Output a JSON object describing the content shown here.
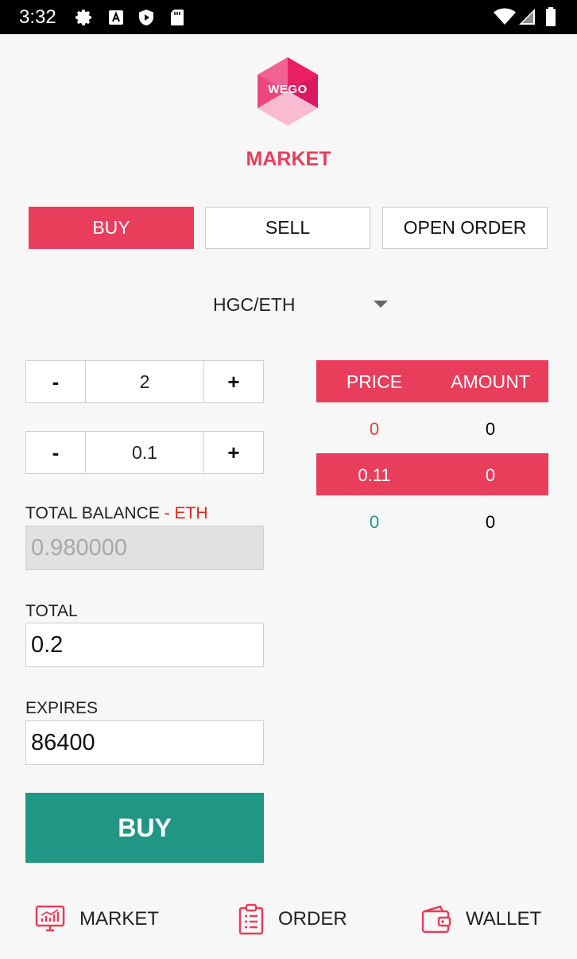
{
  "status_bar": {
    "time": "3:32",
    "icons": [
      "gear-icon",
      "font-a-icon",
      "shield-play-icon",
      "sd-card-icon",
      "wifi-icon",
      "cell-signal-icon",
      "battery-icon"
    ]
  },
  "app": {
    "logo_text": "WEGO",
    "title": "MARKET",
    "accent_color": "#e83e5c",
    "buy_color": "#219685"
  },
  "tabs": [
    {
      "label": "BUY",
      "active": true
    },
    {
      "label": "SELL",
      "active": false
    },
    {
      "label": "OPEN ORDER",
      "active": false
    }
  ],
  "pair_select": {
    "value": "HGC/ETH"
  },
  "steppers": [
    {
      "minus": "-",
      "value": "2",
      "plus": "+"
    },
    {
      "minus": "-",
      "value": "0.1",
      "plus": "+"
    }
  ],
  "order_book": {
    "headers": {
      "price": "PRICE",
      "amount": "AMOUNT"
    },
    "rows": [
      {
        "price": "0",
        "amount": "0",
        "price_color": "#e3413f"
      },
      {
        "price": "0.11",
        "amount": "0",
        "highlight": true
      },
      {
        "price": "0",
        "amount": "0",
        "price_color": "#219685"
      }
    ]
  },
  "form": {
    "total_balance_label": "TOTAL BALANCE",
    "total_balance_suffix": " - ETH",
    "total_balance_value": "0.980000",
    "total_label": "TOTAL",
    "total_value": "0.2",
    "expires_label": "EXPIRES",
    "expires_value": "86400",
    "buy_button": "BUY"
  },
  "bottom_nav": [
    {
      "label": "MARKET",
      "icon": "market-chart-icon"
    },
    {
      "label": "ORDER",
      "icon": "clipboard-icon"
    },
    {
      "label": "WALLET",
      "icon": "wallet-icon"
    }
  ]
}
